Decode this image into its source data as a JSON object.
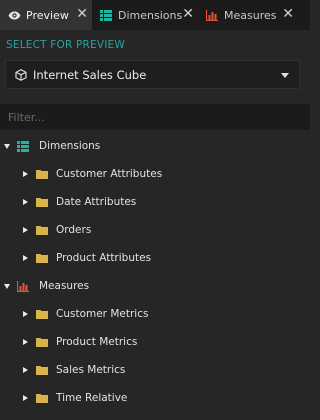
{
  "tabs": [
    {
      "label": "Preview",
      "icon": "eye-icon",
      "active": true
    },
    {
      "label": "Dimensions",
      "icon": "dimensions-icon",
      "active": false
    },
    {
      "label": "Measures",
      "icon": "measures-icon",
      "active": false
    }
  ],
  "preview": {
    "section_label": "SELECT FOR PREVIEW",
    "cube_select": {
      "value": "Internet Sales Cube",
      "icon": "cube-icon"
    },
    "filter": {
      "placeholder": "Filter...",
      "value": ""
    }
  },
  "tree": {
    "dimensions": {
      "label": "Dimensions",
      "icon": "dimensions-icon",
      "children": [
        "Customer Attributes",
        "Date Attributes",
        "Orders",
        "Product Attributes"
      ]
    },
    "measures": {
      "label": "Measures",
      "icon": "measures-icon",
      "children": [
        "Customer Metrics",
        "Product Metrics",
        "Sales Metrics",
        "Time Relative"
      ]
    }
  },
  "colors": {
    "accent": "#2aa3a3",
    "folder": "#d8b44a",
    "dimensions_icon": "#1fb5a3",
    "measures_icon": "#e0553b",
    "background": "#262626"
  }
}
